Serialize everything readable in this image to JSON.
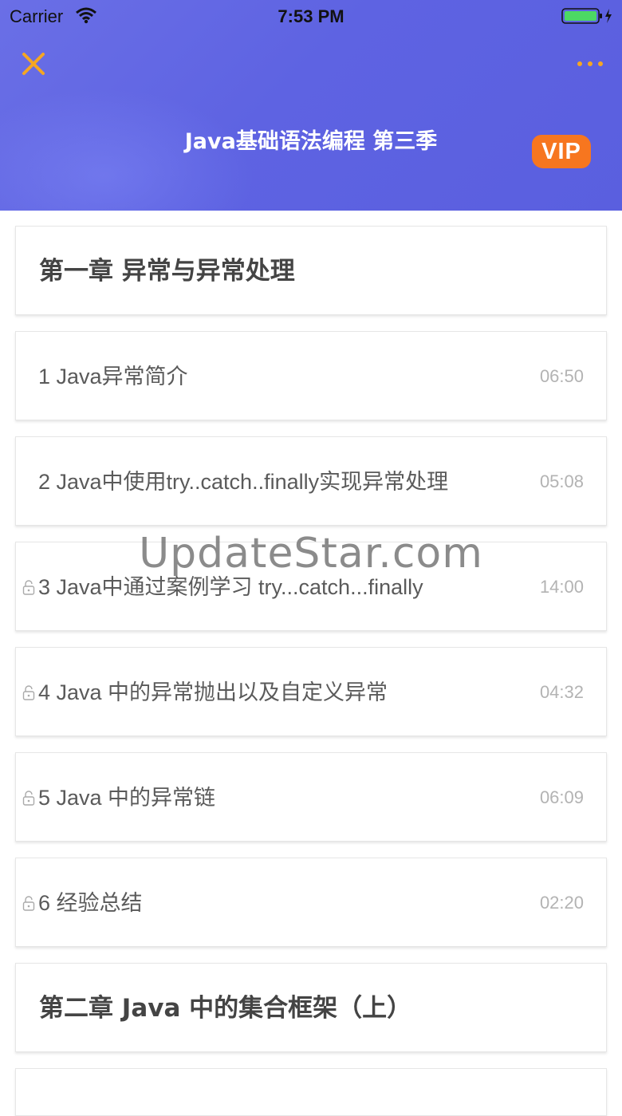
{
  "status_bar": {
    "carrier": "Carrier",
    "time": "7:53 PM"
  },
  "header": {
    "title": "Java基础语法编程 第三季",
    "vip_label": "VIP"
  },
  "sections": [
    {
      "chapter": "第一章 异常与异常处理"
    },
    {
      "lesson": "1 Java异常简介",
      "duration": "06:50",
      "locked": false
    },
    {
      "lesson": "2 Java中使用try..catch..finally实现异常处理",
      "duration": "05:08",
      "locked": false
    },
    {
      "lesson": "3 Java中通过案例学习 try...catch...finally",
      "duration": "14:00",
      "locked": true
    },
    {
      "lesson": "4 Java 中的异常抛出以及自定义异常",
      "duration": "04:32",
      "locked": true
    },
    {
      "lesson": "5 Java 中的异常链",
      "duration": "06:09",
      "locked": true
    },
    {
      "lesson": "6 经验总结",
      "duration": "02:20",
      "locked": true
    },
    {
      "chapter": "第二章 Java 中的集合框架（上）"
    }
  ],
  "watermark": "UpdateStar.com",
  "colors": {
    "accent": "#f5a623",
    "vip": "#f7761f",
    "header_bg": "#5e63e2"
  }
}
